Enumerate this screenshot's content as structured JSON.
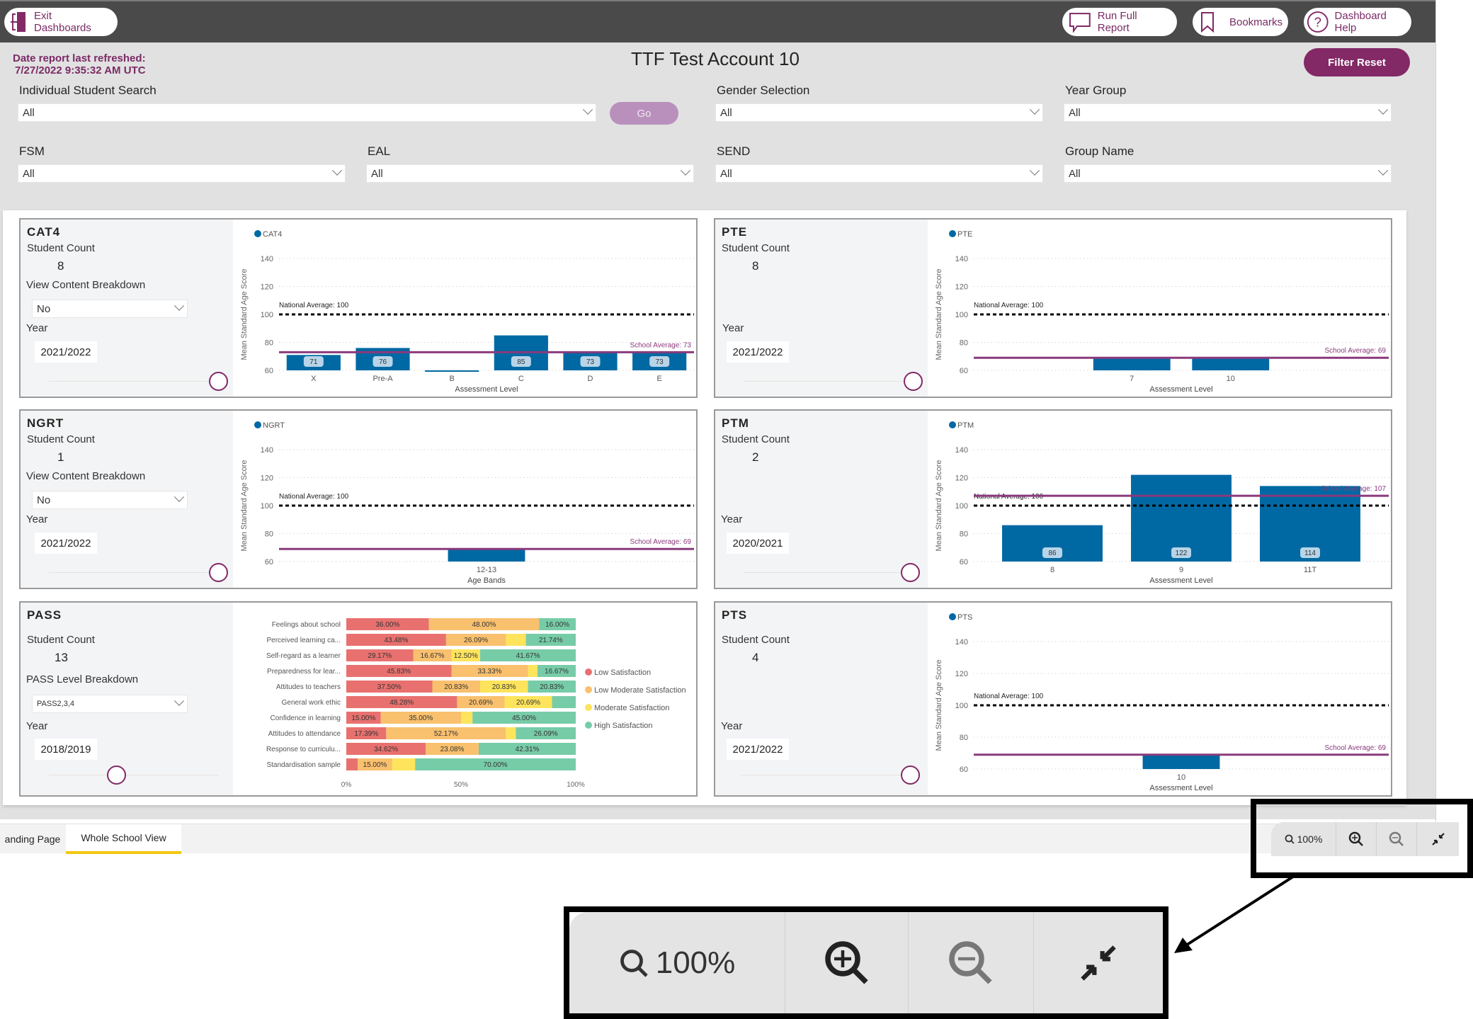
{
  "header": {
    "exit_label": "Exit Dashboards",
    "run_report_label": "Run Full Report",
    "bookmarks_label": "Bookmarks",
    "help_label": "Dashboard Help"
  },
  "refresh": {
    "line1": "Date report last refreshed:",
    "line2": "7/27/2022 9:35:32 AM UTC"
  },
  "page_title": "TTF Test Account 10",
  "filter_reset_label": "Filter Reset",
  "filters": {
    "student_search": {
      "label": "Individual Student Search",
      "value": "All"
    },
    "go_label": "Go",
    "gender": {
      "label": "Gender Selection",
      "value": "All"
    },
    "year_group": {
      "label": "Year Group",
      "value": "All"
    },
    "fsm": {
      "label": "FSM",
      "value": "All"
    },
    "eal": {
      "label": "EAL",
      "value": "All"
    },
    "send": {
      "label": "SEND",
      "value": "All"
    },
    "group_name": {
      "label": "Group Name",
      "value": "All"
    }
  },
  "common": {
    "student_count_label": "Student Count",
    "view_breakdown_label": "View Content Breakdown",
    "year_label": "Year",
    "y_axis_label": "Mean Standard Age Score",
    "national_label": "National Average: 100"
  },
  "cards": {
    "cat4": {
      "title": "CAT4",
      "count": "8",
      "breakdown": "No",
      "year": "2021/2022",
      "slider": 1.0
    },
    "pte": {
      "title": "PTE",
      "count": "8",
      "year": "2021/2022",
      "slider": 1.0
    },
    "ngrt": {
      "title": "NGRT",
      "count": "1",
      "breakdown": "No",
      "year": "2021/2022",
      "slider": 1.0
    },
    "ptm": {
      "title": "PTM",
      "count": "2",
      "year": "2020/2021",
      "slider": 1.0
    },
    "pass": {
      "title": "PASS",
      "count": "13",
      "breakdown_label": "PASS Level Breakdown",
      "breakdown": "PASS2,3,4",
      "year": "2018/2019",
      "slider": 0.4
    },
    "pts": {
      "title": "PTS",
      "count": "4",
      "year": "2021/2022",
      "slider": 1.0
    }
  },
  "chart_data": [
    {
      "id": "cat4",
      "type": "bar",
      "legend": "CAT4",
      "categories": [
        "X",
        "Pre-A",
        "B",
        "C",
        "D",
        "E"
      ],
      "values": [
        71,
        76,
        60,
        85,
        73,
        73
      ],
      "labels": [
        "71",
        "76",
        "",
        "85",
        "73",
        "73"
      ],
      "xlabel": "Assessment Level",
      "ylabel": "Mean Standard Age Score",
      "ylim": [
        60,
        140
      ],
      "yticks": [
        60,
        80,
        100,
        120,
        140
      ],
      "national_average": 100,
      "school_average": 73,
      "school_label": "School Average: 73"
    },
    {
      "id": "pte",
      "type": "bar",
      "legend": "PTE",
      "categories": [
        "7",
        "10"
      ],
      "values": [
        69,
        69
      ],
      "labels": [
        "",
        ""
      ],
      "xlabel": "Assessment Level",
      "ylabel": "Mean Standard Age Score",
      "ylim": [
        60,
        140
      ],
      "yticks": [
        60,
        80,
        100,
        120,
        140
      ],
      "national_average": 100,
      "school_average": 69,
      "school_label": "School Average: 69"
    },
    {
      "id": "ngrt",
      "type": "bar",
      "legend": "NGRT",
      "categories": [
        "12-13"
      ],
      "values": [
        69
      ],
      "labels": [
        ""
      ],
      "xlabel": "Age Bands",
      "ylabel": "Mean Standard Age Score",
      "ylim": [
        60,
        140
      ],
      "yticks": [
        60,
        80,
        100,
        120,
        140
      ],
      "national_average": 100,
      "school_average": 69,
      "school_label": "School Average: 69"
    },
    {
      "id": "ptm",
      "type": "bar",
      "legend": "PTM",
      "categories": [
        "8",
        "9",
        "11T"
      ],
      "values": [
        86,
        122,
        114
      ],
      "labels": [
        "86",
        "122",
        "114"
      ],
      "xlabel": "Assessment Level",
      "ylabel": "Mean Standard Age Score",
      "ylim": [
        60,
        140
      ],
      "yticks": [
        60,
        80,
        100,
        120,
        140
      ],
      "national_average": 100,
      "school_average": 107,
      "school_label": "School Average: 107"
    },
    {
      "id": "pts",
      "type": "bar",
      "legend": "PTS",
      "categories": [
        "10"
      ],
      "values": [
        69
      ],
      "labels": [
        ""
      ],
      "xlabel": "Assessment Level",
      "ylabel": "Mean Standard Age Score",
      "ylim": [
        60,
        140
      ],
      "yticks": [
        60,
        80,
        100,
        120,
        140
      ],
      "national_average": 100,
      "school_average": 69,
      "school_label": "School Average: 69"
    },
    {
      "id": "pass",
      "type": "bar",
      "stacked": "100%",
      "orientation": "horizontal",
      "categories": [
        "Feelings about school",
        "Perceived learning ca...",
        "Self-regard as a learner",
        "Preparedness for lear...",
        "Attitudes to teachers",
        "General work ethic",
        "Confidence in learning",
        "Attitudes to attendance",
        "Response to curriculu...",
        "Standardisation sample"
      ],
      "series": [
        {
          "name": "Low Satisfaction",
          "color": "#e8716f",
          "values": [
            36.0,
            43.48,
            29.17,
            45.83,
            37.5,
            48.28,
            15.0,
            17.39,
            34.62,
            5.0
          ]
        },
        {
          "name": "Low Moderate Satisfaction",
          "color": "#f9c06e",
          "values": [
            48.0,
            26.09,
            16.67,
            33.33,
            20.83,
            20.69,
            35.0,
            52.17,
            23.08,
            15.0
          ]
        },
        {
          "name": "Moderate Satisfaction",
          "color": "#fde45c",
          "values": [
            0,
            8.69,
            12.5,
            4.17,
            20.83,
            20.69,
            5.0,
            4.35,
            0,
            10.0
          ]
        },
        {
          "name": "High Satisfaction",
          "color": "#77cca8",
          "values": [
            16.0,
            21.74,
            41.67,
            16.67,
            20.83,
            10.34,
            45.0,
            26.09,
            42.31,
            70.0
          ]
        }
      ],
      "shown_labels": [
        [
          "36.00%",
          "48.00%",
          "",
          "16.00%"
        ],
        [
          "43.48%",
          "26.09%",
          "",
          "21.74%"
        ],
        [
          "29.17%",
          "16.67%",
          "12.50%",
          "41.67%"
        ],
        [
          "45.83%",
          "33.33%",
          "",
          "16.67%"
        ],
        [
          "37.50%",
          "20.83%",
          "20.83%",
          "20.83%"
        ],
        [
          "48.28%",
          "20.69%",
          "20.69%",
          ""
        ],
        [
          "15.00%",
          "35.00%",
          "",
          "45.00%"
        ],
        [
          "17.39%",
          "52.17%",
          "",
          "26.09%"
        ],
        [
          "34.62%",
          "23.08%",
          "",
          "42.31%"
        ],
        [
          "",
          "15.00%",
          "",
          "70.00%"
        ]
      ],
      "xticks": [
        "0%",
        "50%",
        "100%"
      ],
      "legend_position": "right"
    }
  ],
  "colors": {
    "brand": "#822966",
    "bar": "#0069a3",
    "school_line": "#8a3a7c",
    "national_line": "#000000"
  },
  "tabs": [
    {
      "label": "anding Page",
      "active": false
    },
    {
      "label": "Whole School View",
      "active": true
    }
  ],
  "zoom": {
    "level": "100%"
  }
}
